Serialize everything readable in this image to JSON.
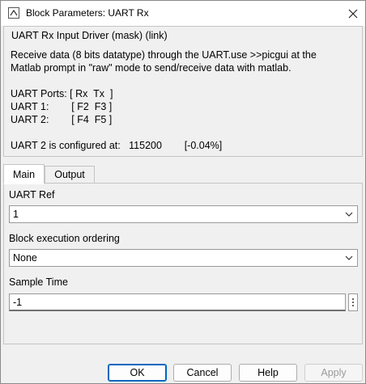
{
  "window": {
    "title": "Block Parameters: UART Rx"
  },
  "description": {
    "group_title": "UART Rx Input Driver (mask) (link)",
    "lines": [
      "Receive data (8 bits datatype) through the UART.use >>picgui at the",
      "Matlab prompt in \"raw\" mode to send/receive data with matlab.",
      "",
      "UART Ports: [ Rx  Tx  ]",
      "UART 1:        [ F2  F3 ]",
      "UART 2:        [ F4  F5 ]",
      "",
      "UART 2 is configured at:   115200        [-0.04%]"
    ]
  },
  "tabs": [
    {
      "label": "Main",
      "active": true
    },
    {
      "label": "Output",
      "active": false
    }
  ],
  "params": {
    "uart_ref": {
      "label": "UART Ref",
      "value": "1"
    },
    "exec_order": {
      "label": "Block execution ordering",
      "value": "None"
    },
    "sample_time": {
      "label": "Sample Time",
      "value": "-1"
    }
  },
  "buttons": {
    "ok": "OK",
    "cancel": "Cancel",
    "help": "Help",
    "apply": "Apply"
  },
  "icons": {
    "title": "simulink-block-icon",
    "close": "close-icon",
    "dropdown": "chevron-down-icon",
    "more": "more-vertical-icon"
  },
  "colors": {
    "primary_border": "#0067c0",
    "background": "#f0f0f0"
  }
}
